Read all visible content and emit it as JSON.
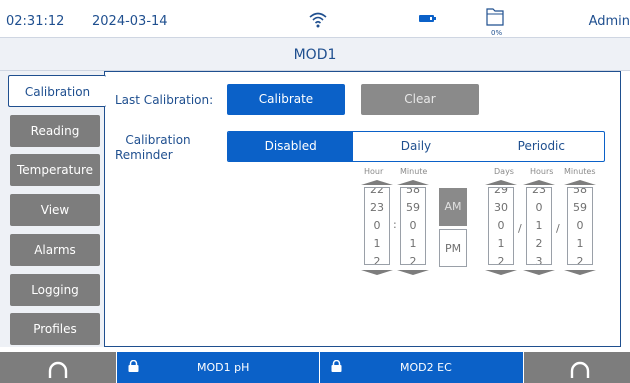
{
  "status": {
    "time": "02:31:12",
    "date": "2024-03-14",
    "storage_pct": "0%",
    "user": "Admin",
    "icons": [
      "wifi-icon",
      "battery-icon",
      "folder-icon"
    ]
  },
  "title": "MOD1",
  "tabs": [
    {
      "label": "Calibration",
      "active": true
    },
    {
      "label": "Reading"
    },
    {
      "label": "Temperature"
    },
    {
      "label": "View"
    },
    {
      "label": "Alarms"
    },
    {
      "label": "Logging"
    },
    {
      "label": "Profiles"
    }
  ],
  "calibration": {
    "last_label": "Last Calibration:",
    "calibrate_button": "Calibrate",
    "clear_button": "Clear",
    "reminder_label_line1": "Calibration",
    "reminder_label_line2": "Reminder",
    "reminder_options": [
      "Disabled",
      "Daily",
      "Periodic"
    ],
    "reminder_selected": "Disabled"
  },
  "time_picker": {
    "hour_label": "Hour",
    "minute_label": "Minute",
    "hour_values": [
      "22",
      "23",
      "0",
      "1",
      "2"
    ],
    "minute_values": [
      "58",
      "59",
      "0",
      "1",
      "2"
    ],
    "am": "AM",
    "pm": "PM",
    "time_separator": ":"
  },
  "period_picker": {
    "days_label": "Days",
    "hours_label": "Hours",
    "minutes_label": "Minutes",
    "days_values": [
      "29",
      "30",
      "0",
      "1",
      "2"
    ],
    "hours_values": [
      "23",
      "0",
      "1",
      "2",
      "3"
    ],
    "minutes_values": [
      "58",
      "59",
      "0",
      "1",
      "2"
    ],
    "separator": "/"
  },
  "bottom": {
    "mod1_label": "MOD1 pH",
    "mod2_label": "MOD2 EC"
  },
  "colors": {
    "accent": "#0b61c8",
    "text": "#1f4f8f",
    "tab_gray": "#7d7d7d"
  }
}
